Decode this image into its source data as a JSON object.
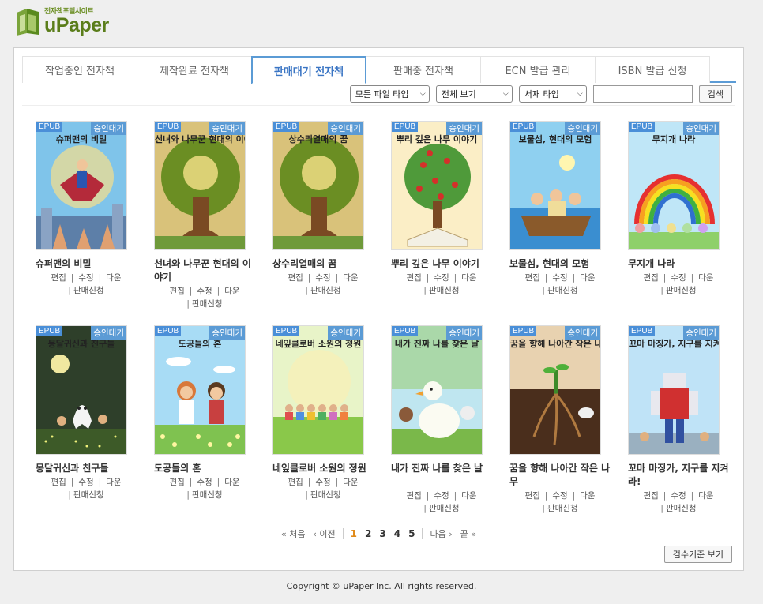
{
  "brand": {
    "tagline": "전자책포털사이트",
    "name": "uPaper",
    "colors": {
      "primary": "#5a7d1a",
      "accent": "#5b9bd5",
      "active_page": "#e08a1a"
    }
  },
  "tabs": [
    {
      "label": "작업중인 전자책",
      "active": false
    },
    {
      "label": "제작완료 전자책",
      "active": false
    },
    {
      "label": "판매대기 전자책",
      "active": true
    },
    {
      "label": "판매중 전자책",
      "active": false
    },
    {
      "label": "ECN 발급 관리",
      "active": false
    },
    {
      "label": "ISBN 발급 신청",
      "active": false
    }
  ],
  "filters": {
    "file_type": "모든 파일 타입",
    "view": "전체 보기",
    "book_type": "서재 타입",
    "search_value": "",
    "search_button": "검색"
  },
  "card_labels": {
    "format": "EPUB",
    "status": "승인대기",
    "edit": "편집",
    "modify": "수정",
    "download": "다운",
    "sale_request": "판매신청"
  },
  "books": [
    {
      "cover_title": "슈퍼맨의 비밀",
      "title": "슈퍼맨의 비밀",
      "art": "superhero"
    },
    {
      "cover_title": "선녀와 나무꾼 현대의 이야기",
      "title": "선녀와 나무꾼 현대의 이야기",
      "art": "tree"
    },
    {
      "cover_title": "상수리열매의 꿈",
      "title": "상수리열매의 꿈",
      "art": "tree"
    },
    {
      "cover_title": "뿌리 깊은 나무 이야기",
      "title": "뿌리 깊은 나무 이야기",
      "art": "appletree"
    },
    {
      "cover_title": "보물섬, 현대의 모험",
      "title": "보물섬, 현대의 모험",
      "art": "boat"
    },
    {
      "cover_title": "무지개 나라",
      "title": "무지개 나라",
      "art": "rainbow"
    },
    {
      "cover_title": "몽달귀신과 친구들",
      "title": "몽달귀신과 친구들",
      "art": "ghost"
    },
    {
      "cover_title": "도공들의 혼",
      "title": "도공들의 혼",
      "art": "friends"
    },
    {
      "cover_title": "네잎클로버 소원의 정원",
      "title": "네잎클로버 소원의 정원",
      "art": "meadow"
    },
    {
      "cover_title": "내가 진짜 나를 찾은 날",
      "title": "내가 진짜 나를 찾은 날",
      "art": "duck"
    },
    {
      "cover_title": "꿈을 향해 나아간 작은 나무",
      "title": "꿈을 향해 나아간 작은 나무",
      "art": "sprout"
    },
    {
      "cover_title": "꼬마 마징가, 지구를 지켜라!",
      "title": "꼬마 마징가, 지구를 지켜라!",
      "art": "robot"
    }
  ],
  "pagination": {
    "first": "처음",
    "prev": "이전",
    "pages": [
      "1",
      "2",
      "3",
      "4",
      "5"
    ],
    "current": "1",
    "next": "다음",
    "last": "끝"
  },
  "guide_button": "검수기준 보기",
  "footer": "Copyright © uPaper Inc. All rights reserved."
}
